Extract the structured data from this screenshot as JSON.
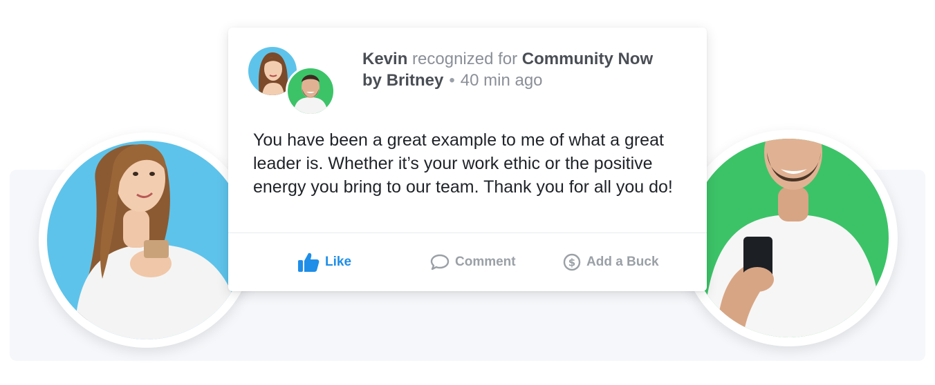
{
  "post": {
    "recipient": "Kevin",
    "recognized_text": "recognized for",
    "award": "Community Now",
    "by_text": "by",
    "giver": "Britney",
    "separator": "•",
    "timestamp": "40 min ago",
    "message": "You have been a great example to me of what a great leader is. Whether it’s your work ethic or the positive energy you bring to our team. Thank you for all you do!"
  },
  "actions": {
    "like_label": "Like",
    "comment_label": "Comment",
    "buck_label": "Add a Buck"
  },
  "icons": {
    "like": "thumbs-up-icon",
    "comment": "speech-bubble-icon",
    "buck": "dollar-coin-icon"
  },
  "colors": {
    "accent_blue": "#1e8ee8",
    "giver_bg": "#5ec3ea",
    "receiver_bg": "#3cc368",
    "muted": "#9aa0a6"
  }
}
